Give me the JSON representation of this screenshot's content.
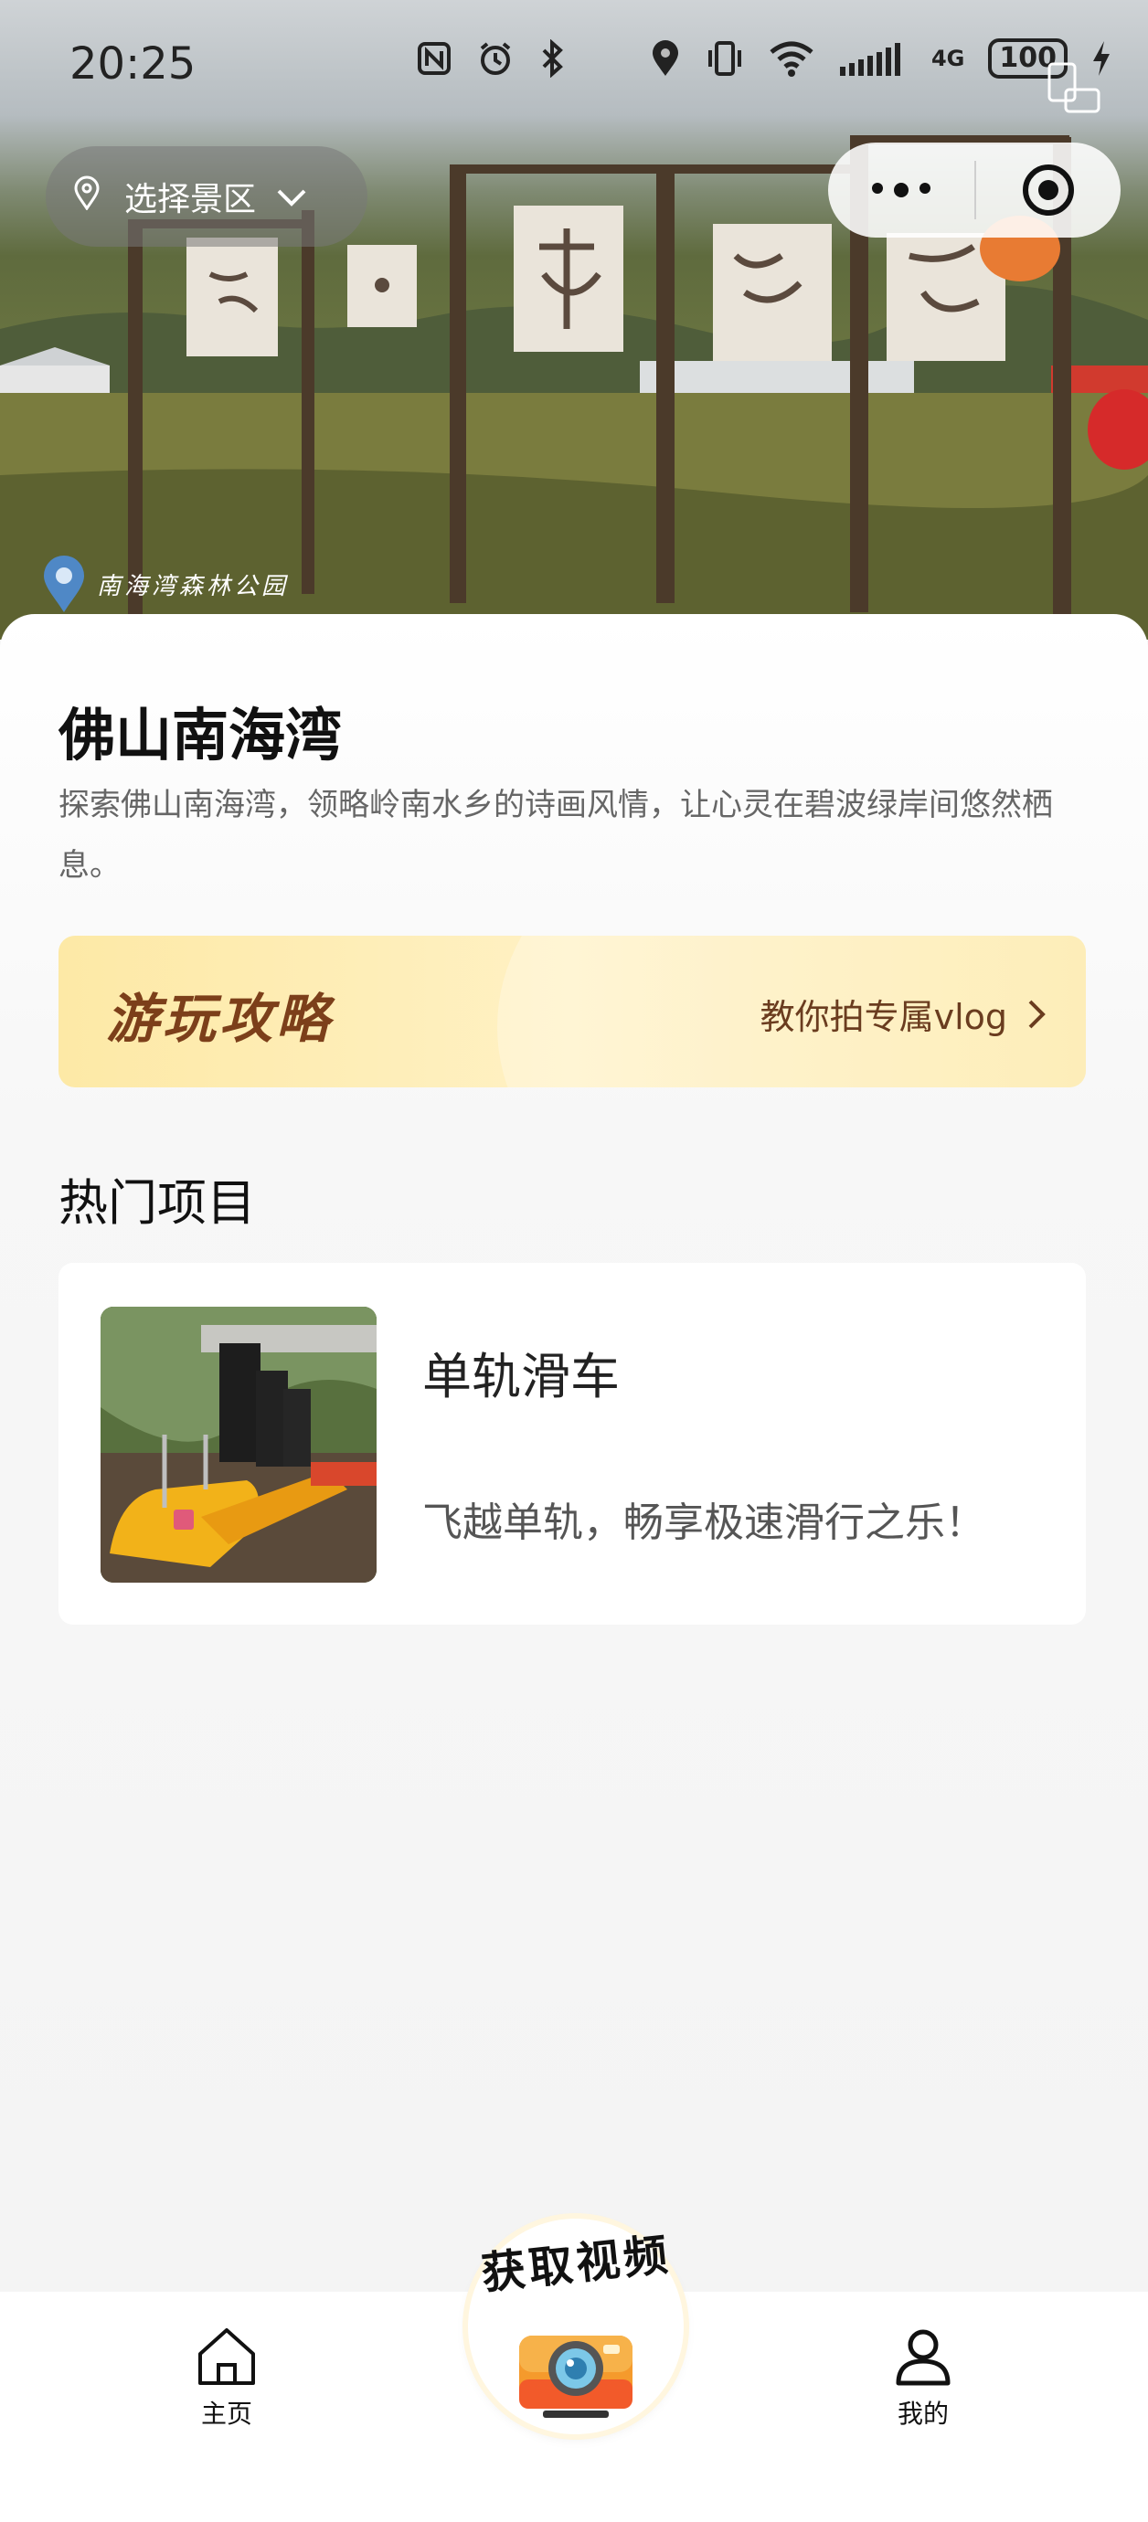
{
  "status_bar": {
    "time": "20:25",
    "network": "4G",
    "battery": "100"
  },
  "header": {
    "location_picker_label": "选择景区",
    "watermark": "南海湾森林公园"
  },
  "main": {
    "title": "佛山南海湾",
    "description": "探索佛山南海湾，领略岭南水乡的诗画风情，让心灵在碧波绿岸间悠然栖息。",
    "guide_banner": {
      "title": "游玩攻略",
      "link_label": "教你拍专属vlog"
    },
    "section_title": "热门项目",
    "items": [
      {
        "name": "单轨滑车",
        "description": "飞越单轨，畅享极速滑行之乐！"
      }
    ]
  },
  "bottom_nav": {
    "home_label": "主页",
    "center_label": "获取视频",
    "mine_label": "我的"
  },
  "colors": {
    "banner_title": "#7c3f1a",
    "banner_bg": "#fde9a6",
    "page_bg": "#f4f4f4"
  }
}
